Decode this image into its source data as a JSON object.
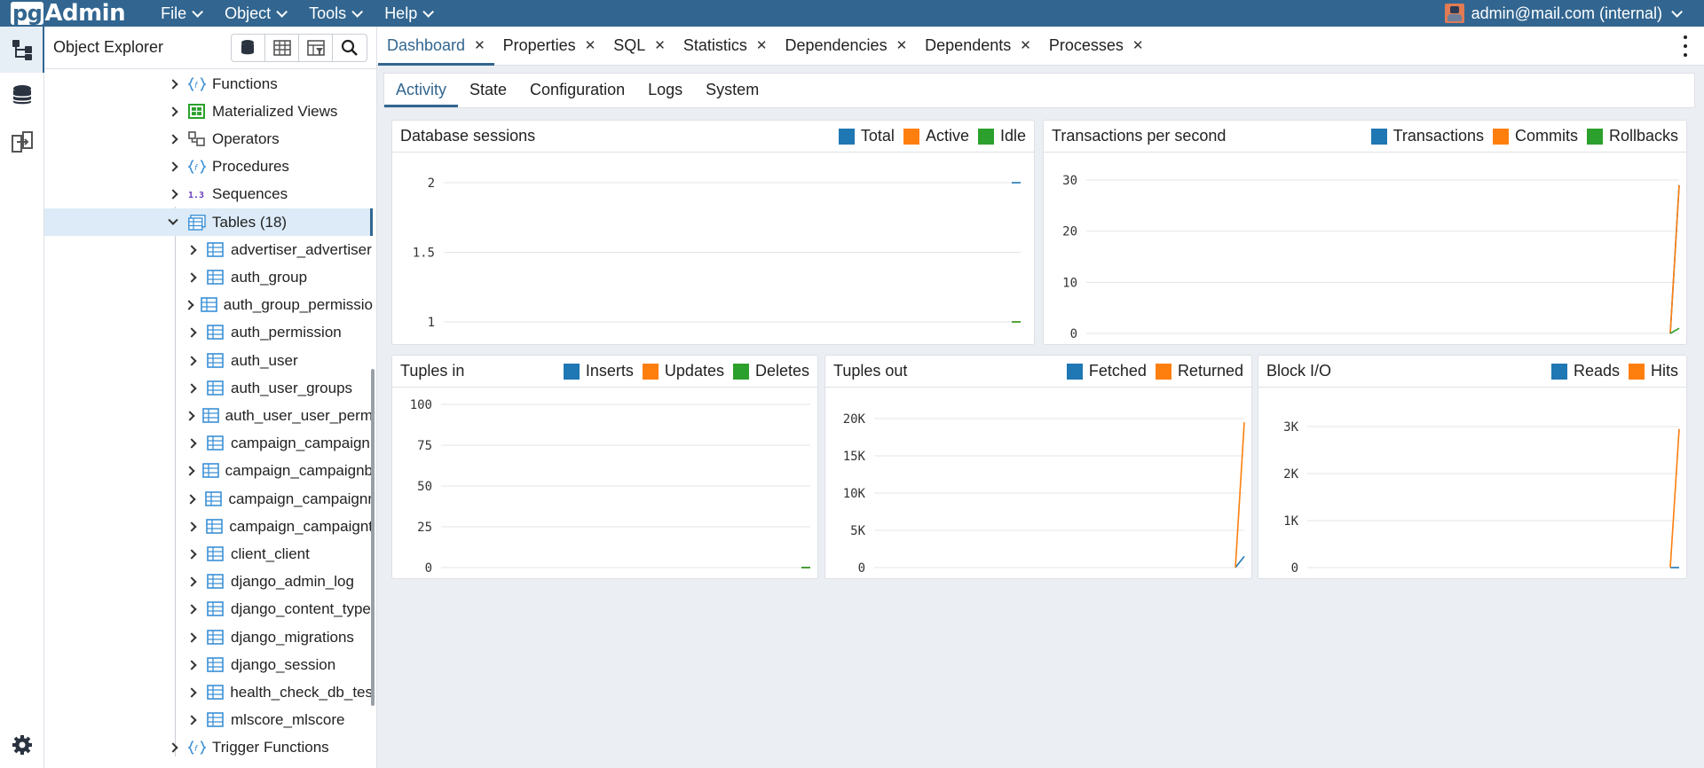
{
  "app": {
    "logo_pg": "pg",
    "logo_admin": "Admin",
    "menu": [
      {
        "label": "File"
      },
      {
        "label": "Object"
      },
      {
        "label": "Tools"
      },
      {
        "label": "Help"
      }
    ],
    "user": "admin@mail.com (internal)"
  },
  "explorer": {
    "title": "Object Explorer",
    "tree": [
      {
        "label": "Functions",
        "icon": "functions-icon",
        "level": 0,
        "expanded": false
      },
      {
        "label": "Materialized Views",
        "icon": "materialized-views-icon",
        "level": 0,
        "expanded": false
      },
      {
        "label": "Operators",
        "icon": "operators-icon",
        "level": 0,
        "expanded": false
      },
      {
        "label": "Procedures",
        "icon": "procedures-icon",
        "level": 0,
        "expanded": false
      },
      {
        "label": "Sequences",
        "icon": "sequences-icon",
        "level": 0,
        "expanded": false
      },
      {
        "label": "Tables (18)",
        "icon": "tables-icon",
        "level": 0,
        "expanded": true,
        "selected": true
      },
      {
        "label": "advertiser_advertiser",
        "icon": "table-icon",
        "level": 1
      },
      {
        "label": "auth_group",
        "icon": "table-icon",
        "level": 1
      },
      {
        "label": "auth_group_permissio",
        "icon": "table-icon",
        "level": 1
      },
      {
        "label": "auth_permission",
        "icon": "table-icon",
        "level": 1
      },
      {
        "label": "auth_user",
        "icon": "table-icon",
        "level": 1
      },
      {
        "label": "auth_user_groups",
        "icon": "table-icon",
        "level": 1
      },
      {
        "label": "auth_user_user_perm",
        "icon": "table-icon",
        "level": 1
      },
      {
        "label": "campaign_campaign",
        "icon": "table-icon",
        "level": 1
      },
      {
        "label": "campaign_campaignb",
        "icon": "table-icon",
        "level": 1
      },
      {
        "label": "campaign_campaignr",
        "icon": "table-icon",
        "level": 1
      },
      {
        "label": "campaign_campaignt",
        "icon": "table-icon",
        "level": 1
      },
      {
        "label": "client_client",
        "icon": "table-icon",
        "level": 1
      },
      {
        "label": "django_admin_log",
        "icon": "table-icon",
        "level": 1
      },
      {
        "label": "django_content_type",
        "icon": "table-icon",
        "level": 1
      },
      {
        "label": "django_migrations",
        "icon": "table-icon",
        "level": 1
      },
      {
        "label": "django_session",
        "icon": "table-icon",
        "level": 1
      },
      {
        "label": "health_check_db_tes",
        "icon": "table-icon",
        "level": 1
      },
      {
        "label": "mlscore_mlscore",
        "icon": "table-icon",
        "level": 1
      },
      {
        "label": "Trigger Functions",
        "icon": "trigger-functions-icon",
        "level": 0,
        "expanded": false
      }
    ]
  },
  "tabs": [
    {
      "label": "Dashboard",
      "active": true
    },
    {
      "label": "Properties"
    },
    {
      "label": "SQL"
    },
    {
      "label": "Statistics"
    },
    {
      "label": "Dependencies"
    },
    {
      "label": "Dependents"
    },
    {
      "label": "Processes"
    }
  ],
  "subtabs": [
    {
      "label": "Activity",
      "active": true
    },
    {
      "label": "State"
    },
    {
      "label": "Configuration"
    },
    {
      "label": "Logs"
    },
    {
      "label": "System"
    }
  ],
  "colors": {
    "blue": "#1f77b4",
    "orange": "#ff7f0e",
    "green": "#2ca02c",
    "brand": "#326690"
  },
  "chart_data": [
    {
      "id": "db-sessions",
      "type": "line",
      "title": "Database sessions",
      "yticks": [
        "2",
        "1.5",
        "1"
      ],
      "ylim": [
        1,
        2
      ],
      "series": [
        {
          "name": "Total",
          "color": "#1f77b4",
          "values": [
            2,
            2
          ]
        },
        {
          "name": "Active",
          "color": "#ff7f0e",
          "values": [
            1,
            1
          ]
        },
        {
          "name": "Idle",
          "color": "#2ca02c",
          "values": [
            1,
            1
          ]
        }
      ]
    },
    {
      "id": "tps",
      "type": "line",
      "title": "Transactions per second",
      "yticks": [
        "30",
        "20",
        "10",
        "0"
      ],
      "ylim": [
        0,
        30
      ],
      "series": [
        {
          "name": "Transactions",
          "color": "#1f77b4",
          "values": [
            0,
            29
          ]
        },
        {
          "name": "Commits",
          "color": "#ff7f0e",
          "values": [
            0,
            29
          ]
        },
        {
          "name": "Rollbacks",
          "color": "#2ca02c",
          "values": [
            0,
            1
          ]
        }
      ]
    },
    {
      "id": "tuples-in",
      "type": "line",
      "title": "Tuples in",
      "yticks": [
        "100",
        "75",
        "50",
        "25",
        "0"
      ],
      "ylim": [
        0,
        100
      ],
      "series": [
        {
          "name": "Inserts",
          "color": "#1f77b4",
          "values": [
            0,
            0
          ]
        },
        {
          "name": "Updates",
          "color": "#ff7f0e",
          "values": [
            0,
            0
          ]
        },
        {
          "name": "Deletes",
          "color": "#2ca02c",
          "values": [
            0,
            0
          ]
        }
      ]
    },
    {
      "id": "tuples-out",
      "type": "line",
      "title": "Tuples out",
      "yticks": [
        "20K",
        "15K",
        "10K",
        "5K",
        "0"
      ],
      "ylim": [
        0,
        20000
      ],
      "series": [
        {
          "name": "Fetched",
          "color": "#1f77b4",
          "values": [
            0,
            1500
          ]
        },
        {
          "name": "Returned",
          "color": "#ff7f0e",
          "values": [
            0,
            19500
          ]
        }
      ]
    },
    {
      "id": "block-io",
      "type": "line",
      "title": "Block I/O",
      "yticks": [
        "3K",
        "2K",
        "1K",
        "0"
      ],
      "ylim": [
        0,
        3000
      ],
      "series": [
        {
          "name": "Reads",
          "color": "#1f77b4",
          "values": [
            0,
            0
          ]
        },
        {
          "name": "Hits",
          "color": "#ff7f0e",
          "values": [
            0,
            2950
          ]
        }
      ]
    }
  ]
}
